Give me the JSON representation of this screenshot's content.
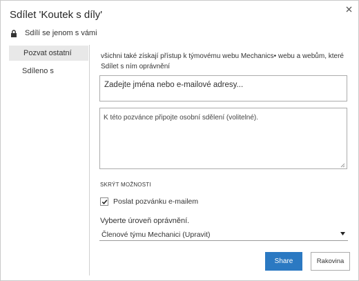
{
  "dialog": {
    "title": "Sdílet 'Koutek s díly'",
    "shared_only_label": "Sdílí se jenom s vámi",
    "close_icon": "close-icon",
    "lock_icon": "lock-icon"
  },
  "nav": {
    "items": [
      {
        "label": "Pozvat ostatní",
        "active": true
      },
      {
        "label": "Sdíleno s",
        "active": false
      }
    ]
  },
  "main": {
    "description": "všichni také získají přístup k týmovému webu Mechanics• webu a webům, které Sdílet s ním oprávnění",
    "names_placeholder": "Zadejte jména nebo e-mailové adresy...",
    "message_placeholder": "K této pozvánce připojte osobní sdělení (volitelné).",
    "hide_options_label": "SKRÝT MOŽNOSTI",
    "send_email_label": "Poslat pozvánku e-mailem",
    "send_email_checked": true,
    "permission_label": "Vyberte úroveň oprávnění.",
    "permission_selected": "Členové týmu Mechanici (Upravit)"
  },
  "buttons": {
    "share_label": "Share",
    "cancel_label": "Rakovina"
  },
  "colors": {
    "accent": "#2b79c2",
    "nav_active_bg": "#e8e8e8"
  }
}
